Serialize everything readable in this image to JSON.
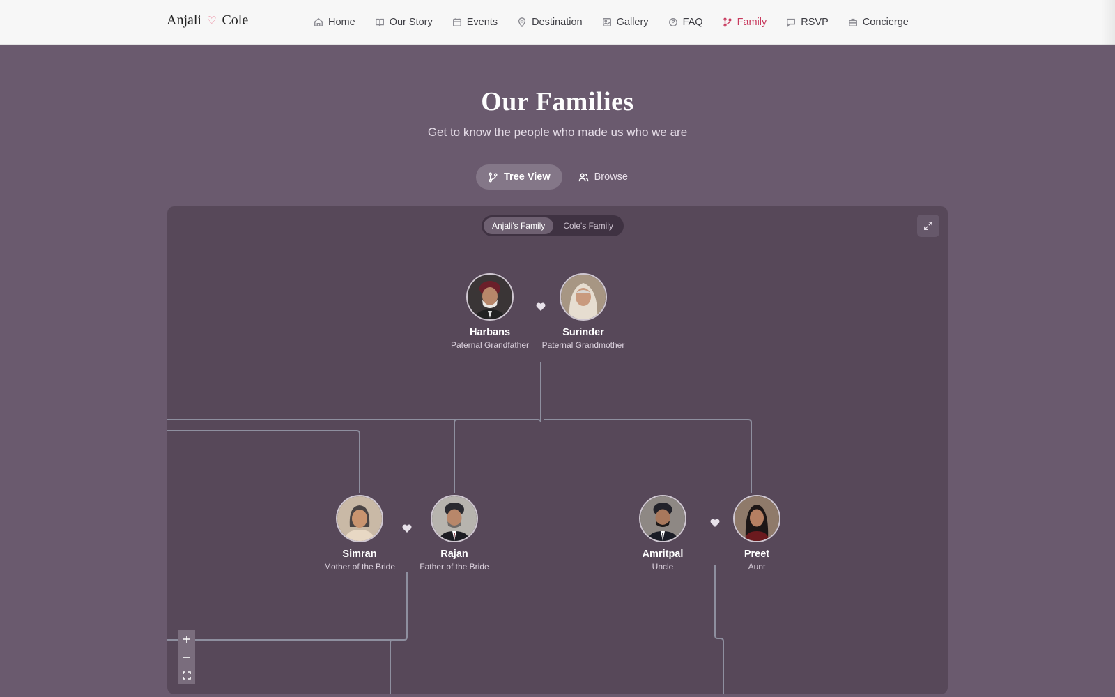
{
  "brand": {
    "left": "Anjali",
    "heart": "♡",
    "right": "Cole"
  },
  "nav": {
    "items": [
      {
        "label": "Home",
        "icon": "home-icon"
      },
      {
        "label": "Our Story",
        "icon": "book-icon"
      },
      {
        "label": "Events",
        "icon": "calendar-icon"
      },
      {
        "label": "Destination",
        "icon": "map-pin-icon"
      },
      {
        "label": "Gallery",
        "icon": "image-icon"
      },
      {
        "label": "FAQ",
        "icon": "help-circle-icon"
      },
      {
        "label": "Family",
        "icon": "git-branch-icon",
        "active": true
      },
      {
        "label": "RSVP",
        "icon": "message-icon"
      },
      {
        "label": "Concierge",
        "icon": "concierge-icon"
      }
    ]
  },
  "page": {
    "title": "Our Families",
    "subtitle": "Get to know the people who made us who we are"
  },
  "view_toggle": {
    "tree": "Tree View",
    "browse": "Browse",
    "selected": "Tree View"
  },
  "family_toggle": {
    "anjali": "Anjali's Family",
    "cole": "Cole's Family",
    "selected": "Anjali's Family"
  },
  "tree": {
    "people": [
      {
        "name": "Harbans",
        "role": "Paternal Grandfather"
      },
      {
        "name": "Surinder",
        "role": "Paternal Grandmother"
      },
      {
        "name": "Simran",
        "role": "Mother of the Bride"
      },
      {
        "name": "Rajan",
        "role": "Father of the Bride"
      },
      {
        "name": "Amritpal",
        "role": "Uncle"
      },
      {
        "name": "Preet",
        "role": "Aunt"
      }
    ]
  },
  "colors": {
    "accent": "#c83a5e",
    "background": "#6a5a6e",
    "panel": "#574859",
    "line": "#8e8f9f"
  }
}
